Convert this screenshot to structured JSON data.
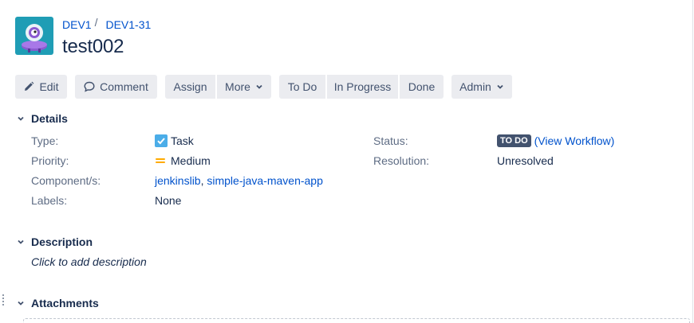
{
  "header": {
    "breadcrumbs": [
      {
        "label": "DEV1"
      },
      {
        "label": "DEV1-31"
      }
    ],
    "separator": "/",
    "title": "test002",
    "avatar_icon": "project-monster-icon"
  },
  "toolbar": {
    "edit_label": "Edit",
    "comment_label": "Comment",
    "assign_label": "Assign",
    "more_label": "More",
    "todo_label": "To Do",
    "inprogress_label": "In Progress",
    "done_label": "Done",
    "admin_label": "Admin"
  },
  "details": {
    "heading": "Details",
    "type_label": "Type:",
    "type_value": "Task",
    "priority_label": "Priority:",
    "priority_value": "Medium",
    "components_label": "Component/s:",
    "components": [
      "jenkinslib",
      "simple-java-maven-app"
    ],
    "components_sep": ", ",
    "labels_label": "Labels:",
    "labels_value": "None",
    "status_label": "Status:",
    "status_value": "TO DO",
    "view_workflow": "(View Workflow)",
    "resolution_label": "Resolution:",
    "resolution_value": "Unresolved"
  },
  "description": {
    "heading": "Description",
    "placeholder": "Click to add description"
  },
  "attachments": {
    "heading": "Attachments"
  },
  "colors": {
    "link": "#0052cc",
    "text": "#172b4d",
    "muted": "#5e6c84",
    "button_bg": "#ebecf0",
    "lozenge_bg": "#42526e",
    "task_icon": "#4bade8",
    "priority_medium": "#ffab00",
    "avatar_bg": "#1f9db5"
  }
}
